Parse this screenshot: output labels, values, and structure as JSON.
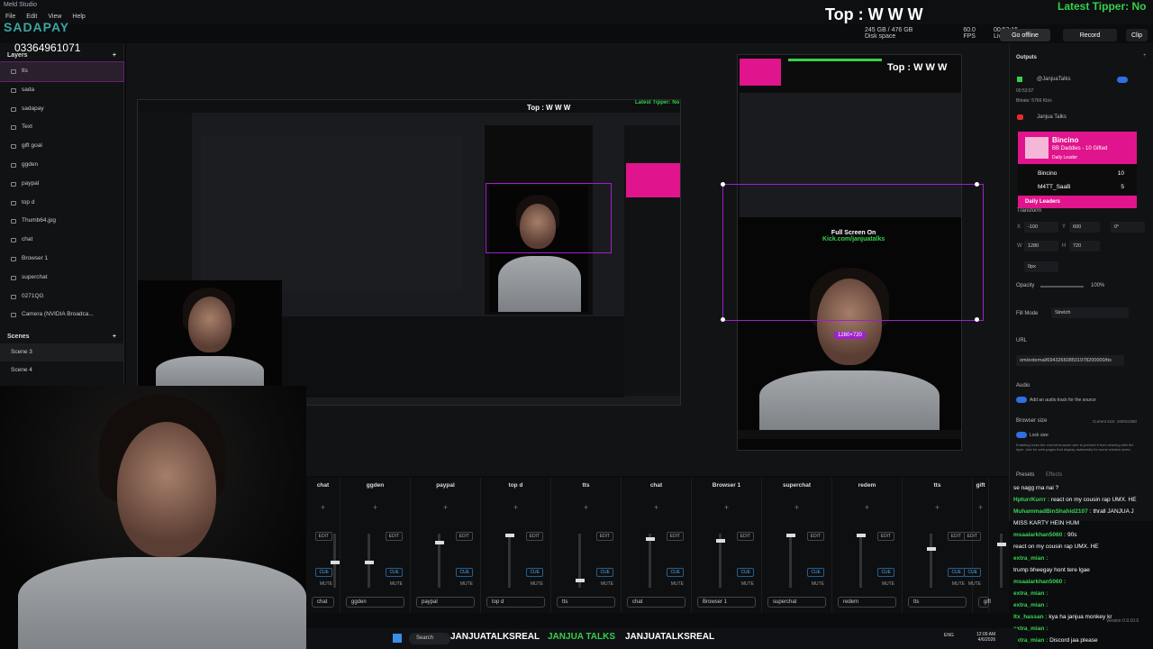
{
  "app": {
    "title": "Meld Studio",
    "menu": [
      "File",
      "Edit",
      "View",
      "Help"
    ]
  },
  "overlay": {
    "phone_logo": "SADAPAY",
    "phone": "03364961071",
    "top_text": "Top : W W W",
    "tipper": "Latest Tipper: No",
    "full_screen": "Full Screen On",
    "kick": "Kick.com/janjuatalks",
    "resolution_badge": "1280×720"
  },
  "stats": [
    {
      "value": "245 GB / 476 GB",
      "label": "Disk space"
    },
    {
      "value": "60.0",
      "label": "FPS"
    },
    {
      "value": "00:53:15",
      "label": "Live"
    }
  ],
  "header_buttons": {
    "offline": "Go offline",
    "record": "Record",
    "clip": "Clip"
  },
  "layers": {
    "title": "Layers",
    "items": [
      "tts",
      "sada",
      "sadapay",
      "Text",
      "gift goal",
      "ggden",
      "paypal",
      "top d",
      "Thumb64.jpg",
      "chat",
      "Browser 1",
      "superchat",
      "0271QG",
      "Camera (NVIDIA Broadca..."
    ]
  },
  "scenes": {
    "title": "Scenes",
    "items": [
      "Scene 3",
      "Scene 4"
    ]
  },
  "mixer": [
    {
      "name": "chat"
    },
    {
      "name": "ggden"
    },
    {
      "name": "paypal"
    },
    {
      "name": "top d"
    },
    {
      "name": "tts"
    },
    {
      "name": "chat"
    },
    {
      "name": "Browser 1"
    },
    {
      "name": "superchat"
    },
    {
      "name": "redem"
    },
    {
      "name": "tts"
    },
    {
      "name": "gift"
    }
  ],
  "mixer_labels": {
    "edit": "EDIT",
    "cue": "CUE",
    "mute": "MUTE"
  },
  "outputs": {
    "title": "Outputs",
    "items": [
      {
        "name": "@JanjuaTalks",
        "time": "00:53:07",
        "bitrate": "Bitrate: 5766 Kb/s"
      },
      {
        "name": "Janjua Talks"
      }
    ]
  },
  "leaders": {
    "top_name": "Bincino",
    "top_detail": "BB Daddies - 10 Gifted",
    "top_tag": "Daily Leader",
    "rows": [
      {
        "name": "Bincino",
        "count": "10"
      },
      {
        "name": "M4TT_SaaB",
        "count": "5"
      }
    ],
    "footer": "Daily Leaders"
  },
  "properties": {
    "transform": "Transform",
    "x": "-100",
    "y": "600",
    "rot": "0°",
    "w": "1280",
    "h": "720",
    "radius": "0px",
    "opacity_label": "Opacity",
    "opacity": "100%",
    "fill_label": "Fill Mode",
    "fill": "Stretch",
    "url_label": "URL",
    "url": "om/external/694326608501978200000/tts",
    "audio_label": "Audio",
    "audio_note": "Add an audio track for the source",
    "browser_label": "Browser size",
    "browser_current": "Current size: 1920x1080",
    "lock_label": "Lock size",
    "lock_note": "Enabling locks the current browser size to prevent it from resizing with the layer. Use for web pages that display awkwardly for some window sizes.",
    "presets": "Presets",
    "effects": "Effects"
  },
  "chat": [
    {
      "user": "",
      "msg": "se nagg rna nai ?"
    },
    {
      "user": "HpturrKurrr :",
      "msg": "react on my cousin rap UMX. HE"
    },
    {
      "user": "MuhammadBinShahid2107 :",
      "msg": "thrall JANJUA J"
    },
    {
      "user": "",
      "msg": "MISS KARTY HEIN HUM"
    },
    {
      "user": "msaalarkhan5060 :",
      "msg": "90s"
    },
    {
      "user": "",
      "msg": "react on my cousin rap UMX. HE"
    },
    {
      "user": "extra_mian :",
      "msg": ""
    },
    {
      "user": "",
      "msg": "trump bheegay hont tere lgae"
    },
    {
      "user": "msaalarkhan5060 :",
      "msg": ""
    },
    {
      "user": "extra_mian :",
      "msg": ""
    },
    {
      "user": "extra_mian :",
      "msg": ""
    },
    {
      "user": "ltx_hassan :",
      "msg": "kya ha janjua monkey kr"
    },
    {
      "user": "extra_mian :",
      "msg": ""
    },
    {
      "user": "extra_mian :",
      "msg": "Discord jaa please"
    }
  ],
  "taskbar": {
    "search": "Search",
    "x_handle": "JANJUATALKSREAL",
    "kick": "JANJUA TALKS",
    "yt": "JANJUATALKSREAL",
    "time": "12:09 AM",
    "date": "4/6/2026",
    "lang": "ENG",
    "version": "Version 0.9.10.0"
  },
  "colors": {
    "accent": "#e0148c",
    "green": "#35d04a",
    "purple": "#a020d0",
    "blue": "#2f6fe0"
  }
}
